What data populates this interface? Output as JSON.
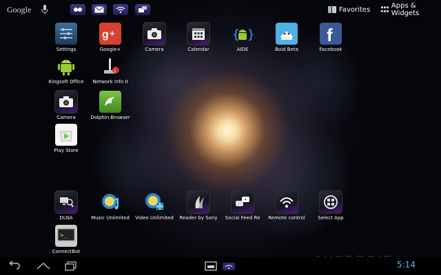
{
  "topbar": {
    "search_label": "Google",
    "favorites_label": "Favorites",
    "apps_widgets_label": "Apps & Widgets",
    "status_icons": [
      "walkman-icon",
      "email-icon",
      "wifi-icon",
      "notification-icon"
    ]
  },
  "apps": [
    {
      "label": "Settings",
      "icon": "settings-icon"
    },
    {
      "label": "Google+",
      "icon": "google-plus-icon"
    },
    {
      "label": "Camera",
      "icon": "camera-icon"
    },
    {
      "label": "Calendar",
      "icon": "calendar-icon"
    },
    {
      "label": "AIDE",
      "icon": "android-icon"
    },
    {
      "label": "Boid Beta",
      "icon": "boid-icon"
    },
    {
      "label": "Facebook",
      "icon": "facebook-icon"
    },
    {
      "label": "Kingsoft Office",
      "icon": "android-icon"
    },
    {
      "label": "Network Info II",
      "icon": "network-info-icon"
    },
    {
      "label": "Camera",
      "icon": "camera-icon"
    },
    {
      "label": "Dolphin Browser",
      "icon": "dolphin-icon"
    },
    {
      "label": "Play Store",
      "icon": "play-store-icon"
    }
  ],
  "dock": [
    {
      "label": "DLNA",
      "icon": "dlna-icon"
    },
    {
      "label": "Music Unlimited",
      "icon": "music-unlimited-icon"
    },
    {
      "label": "Video Unlimited",
      "icon": "video-unlimited-icon"
    },
    {
      "label": "Reader by Sony",
      "icon": "reader-icon"
    },
    {
      "label": "Social Feed Re",
      "icon": "social-feed-icon"
    },
    {
      "label": "Remote control",
      "icon": "remote-control-icon"
    },
    {
      "label": "Select App",
      "icon": "select-app-icon"
    },
    {
      "label": "ConnectBot",
      "icon": "terminal-icon"
    }
  ],
  "status": {
    "time": "5:14"
  },
  "watermark": "AUSDROID",
  "colors": {
    "clock": "#5bbbe6",
    "sony_purple": "#4a1a7a",
    "google_red": "#d8402f",
    "facebook_blue": "#3b5998"
  }
}
